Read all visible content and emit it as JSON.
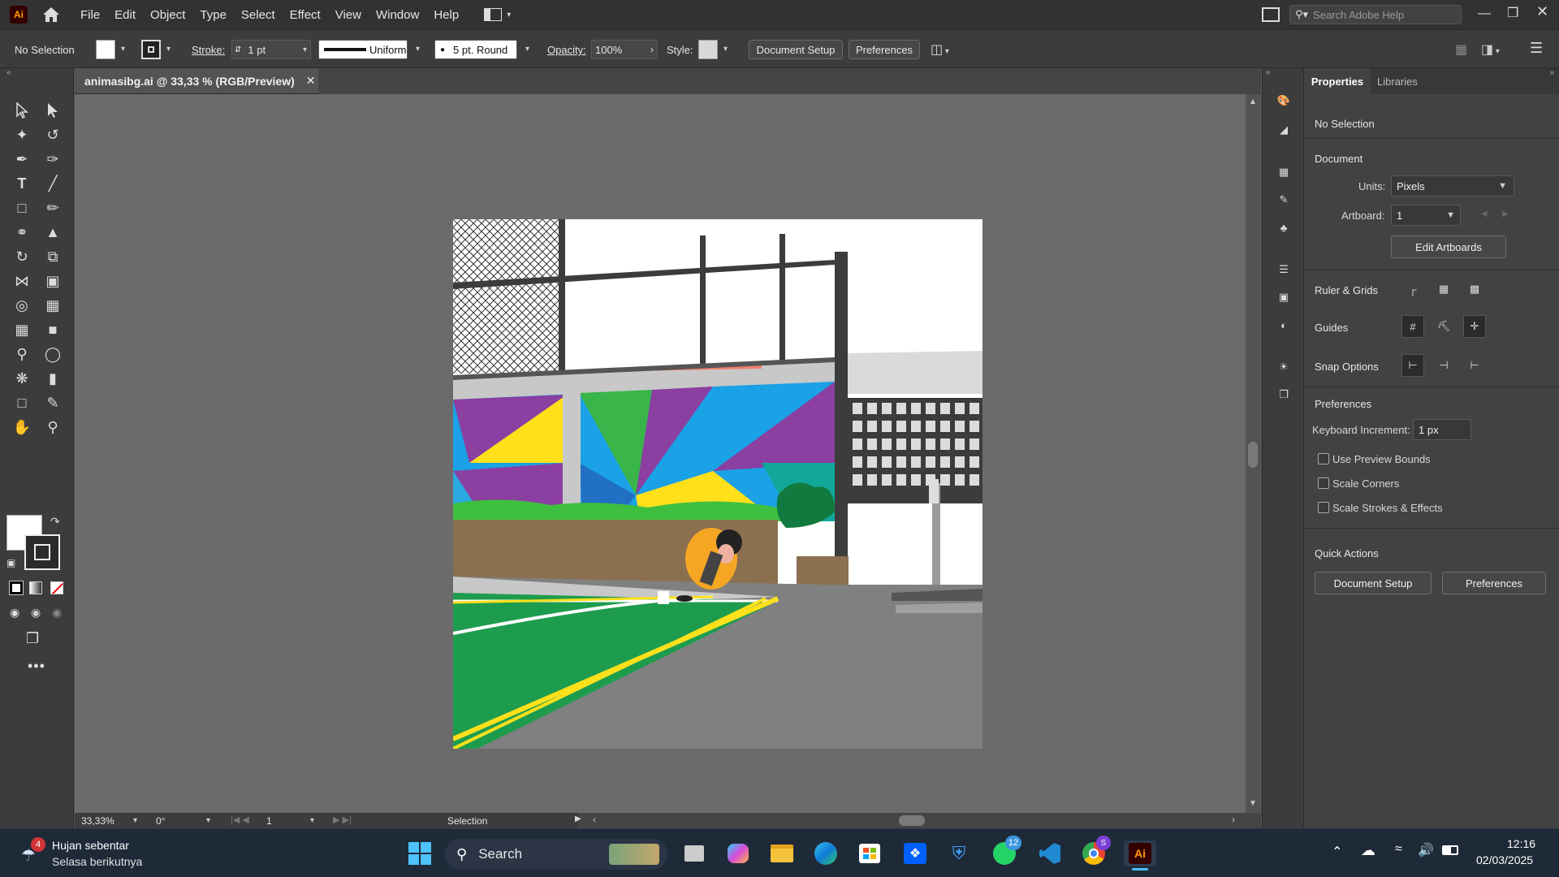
{
  "app": {
    "logo": "Ai",
    "menu": [
      "File",
      "Edit",
      "Object",
      "Type",
      "Select",
      "Effect",
      "View",
      "Window",
      "Help"
    ],
    "search_placeholder": "Search Adobe Help"
  },
  "controlbar": {
    "selection": "No Selection",
    "stroke_label": "Stroke:",
    "stroke_value": "1 pt",
    "stroke_profile": "Uniform",
    "brush": "5 pt. Round",
    "opacity_label": "Opacity:",
    "opacity_value": "100%",
    "style_label": "Style:",
    "doc_setup": "Document Setup",
    "preferences": "Preferences"
  },
  "document": {
    "tab_title": "animasibg.ai @ 33,33 % (RGB/Preview)",
    "close": "✕"
  },
  "statusbar": {
    "zoom": "33,33%",
    "rotation": "0°",
    "artboard_num": "1",
    "tool": "Selection"
  },
  "properties": {
    "tabs": [
      "Properties",
      "Libraries"
    ],
    "no_selection": "No Selection",
    "document_header": "Document",
    "units_label": "Units:",
    "units_value": "Pixels",
    "artboard_label": "Artboard:",
    "artboard_value": "1",
    "edit_artboards": "Edit Artboards",
    "ruler_grids": "Ruler & Grids",
    "guides": "Guides",
    "snap_options": "Snap Options",
    "preferences_header": "Preferences",
    "keyboard_increment_label": "Keyboard Increment:",
    "keyboard_increment_value": "1 px",
    "use_preview_bounds": "Use Preview Bounds",
    "scale_corners": "Scale Corners",
    "scale_strokes": "Scale Strokes & Effects",
    "quick_actions": "Quick Actions",
    "qa_doc_setup": "Document Setup",
    "qa_preferences": "Preferences"
  },
  "taskbar": {
    "weather_title": "Hujan sebentar",
    "weather_sub": "Selasa berikutnya",
    "weather_badge": "4",
    "search": "Search",
    "whatsapp_badge": "12",
    "chrome_badge": "S",
    "ai_label": "Ai",
    "time": "12:16",
    "date": "02/03/2025"
  },
  "colors": {
    "ai_orange": "#ff9a00",
    "panel": "#3c3c3c",
    "canvas": "#6b6b6b"
  }
}
